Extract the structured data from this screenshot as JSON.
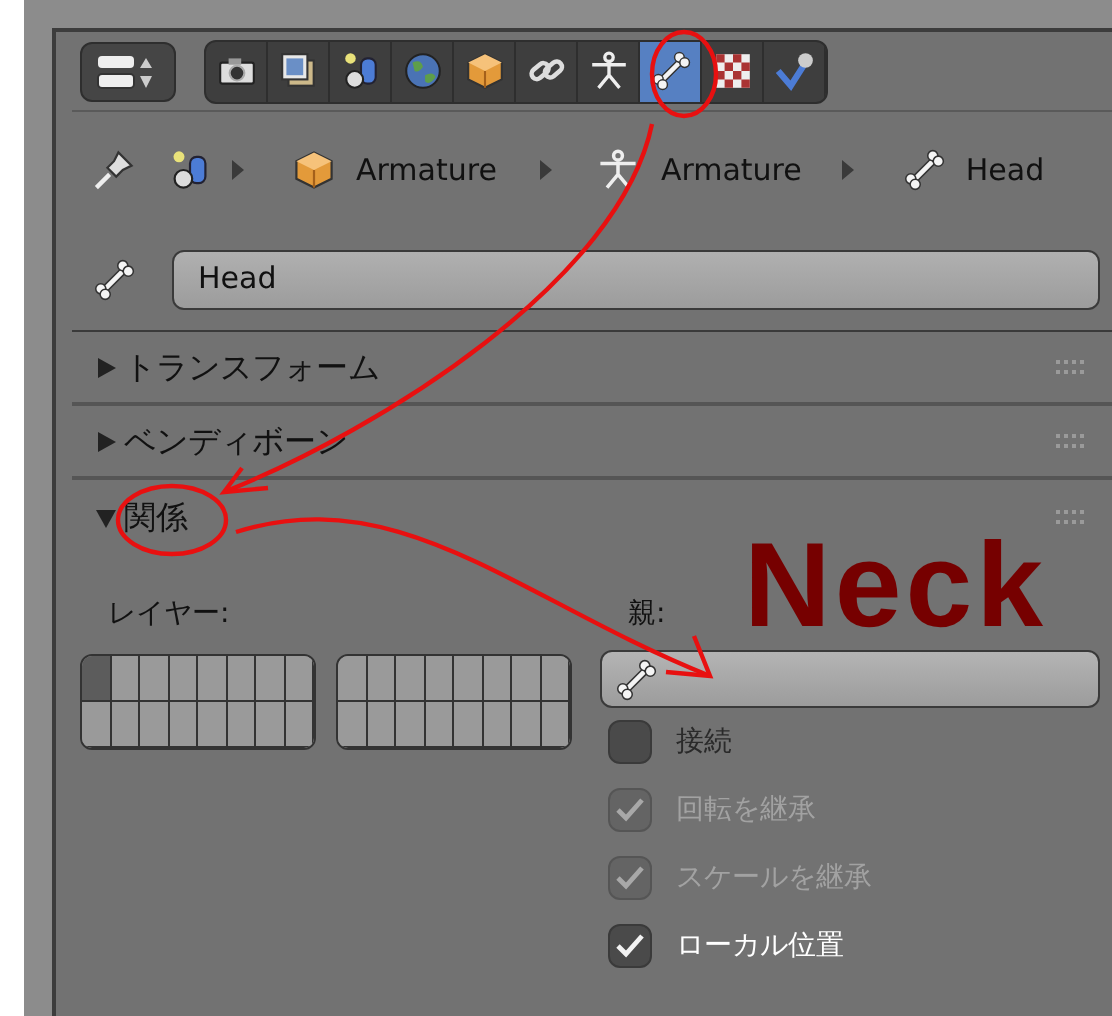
{
  "tabs": [
    {
      "kind": "camera",
      "selected": false
    },
    {
      "kind": "photos",
      "selected": false
    },
    {
      "kind": "spheres",
      "selected": false
    },
    {
      "kind": "globe",
      "selected": false
    },
    {
      "kind": "cube",
      "selected": false
    },
    {
      "kind": "link",
      "selected": false
    },
    {
      "kind": "figure",
      "selected": false
    },
    {
      "kind": "bone",
      "selected": true
    },
    {
      "kind": "checker",
      "selected": false
    },
    {
      "kind": "check",
      "selected": false
    }
  ],
  "breadcrumb": [
    {
      "kind": "spheres"
    },
    {
      "kind": "cube",
      "label": "Armature"
    },
    {
      "kind": "figure",
      "label": "Armature"
    },
    {
      "kind": "bone",
      "label": "Head"
    }
  ],
  "name_field": {
    "value": "Head"
  },
  "panels": [
    {
      "title": "トランスフォーム",
      "expanded": false
    },
    {
      "title": "ベンディボーン",
      "expanded": false
    },
    {
      "title": "関係",
      "expanded": true
    }
  ],
  "relations": {
    "layers_label": "レイヤー:",
    "parent_label": "親:",
    "layer_grids": [
      {
        "cells": [
          {
            "selected": true
          },
          {
            "selected": false
          },
          {
            "selected": false
          },
          {
            "selected": false
          },
          {
            "selected": false
          },
          {
            "selected": false
          },
          {
            "selected": false
          },
          {
            "selected": false
          },
          {
            "selected": false
          },
          {
            "selected": false
          },
          {
            "selected": false
          },
          {
            "selected": false
          },
          {
            "selected": false
          },
          {
            "selected": false
          },
          {
            "selected": false
          },
          {
            "selected": false
          }
        ]
      },
      {
        "cells": [
          {
            "selected": false
          },
          {
            "selected": false
          },
          {
            "selected": false
          },
          {
            "selected": false
          },
          {
            "selected": false
          },
          {
            "selected": false
          },
          {
            "selected": false
          },
          {
            "selected": false
          },
          {
            "selected": false
          },
          {
            "selected": false
          },
          {
            "selected": false
          },
          {
            "selected": false
          },
          {
            "selected": false
          },
          {
            "selected": false
          },
          {
            "selected": false
          },
          {
            "selected": false
          }
        ]
      }
    ],
    "options": [
      {
        "label": "接続",
        "checked": false,
        "disabled": false
      },
      {
        "label": "回転を継承",
        "checked": true,
        "disabled": true
      },
      {
        "label": "スケールを継承",
        "checked": true,
        "disabled": true
      },
      {
        "label": "ローカル位置",
        "checked": true,
        "disabled": false
      }
    ]
  },
  "annotations": {
    "marks": [
      {
        "kind": "circle"
      },
      {
        "kind": "arrow"
      },
      {
        "kind": "circle"
      },
      {
        "kind": "arrow"
      }
    ],
    "note": "Neck"
  }
}
